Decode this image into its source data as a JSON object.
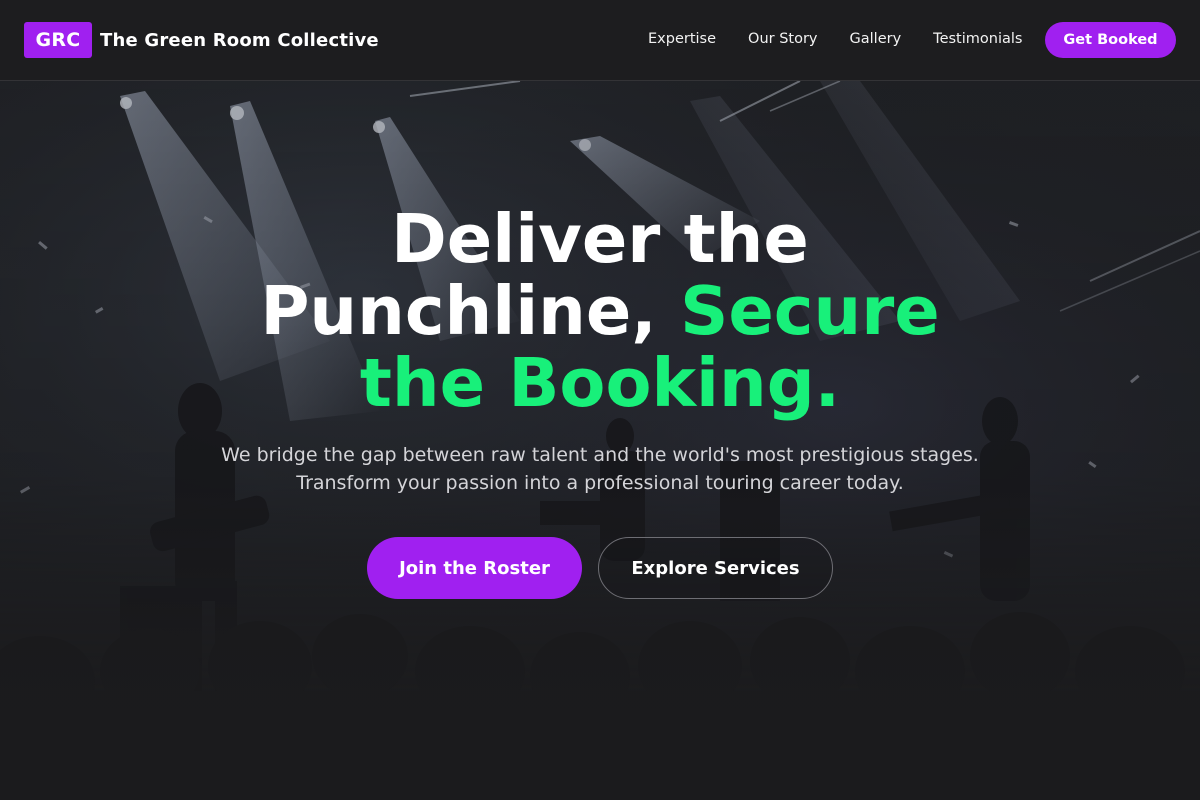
{
  "brand": {
    "logo_text": "GRC",
    "name": "The Green Room Collective",
    "accent_color": "#a020f0"
  },
  "nav": {
    "items": [
      {
        "label": "Expertise"
      },
      {
        "label": "Our Story"
      },
      {
        "label": "Gallery"
      },
      {
        "label": "Testimonials"
      }
    ],
    "cta_label": "Get Booked"
  },
  "hero": {
    "title_line1": "Deliver the",
    "title_line2_plain": "Punchline, ",
    "title_line2_accent": "Secure",
    "title_line3_accent": "the Booking.",
    "accent_color": "#18f07a",
    "subtitle_line1": "We bridge the gap between raw talent and the world's most prestigious stages.",
    "subtitle_line2": "Transform your passion into a professional touring career today.",
    "primary_button": "Join the Roster",
    "secondary_button": "Explore Services"
  }
}
